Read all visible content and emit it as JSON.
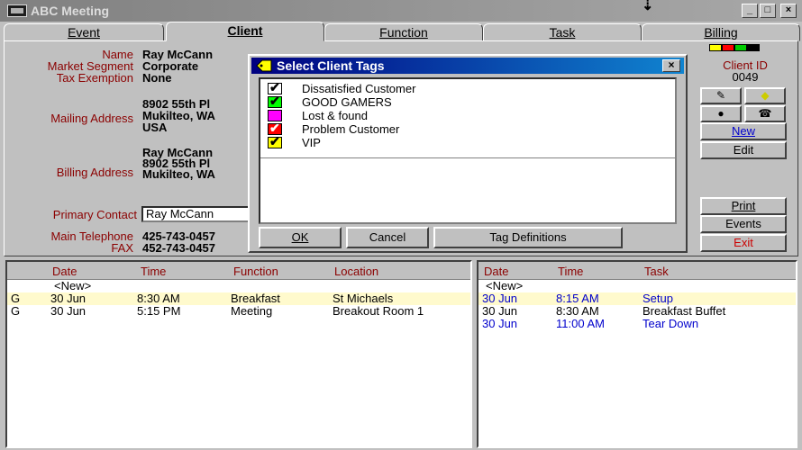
{
  "window": {
    "title": "ABC Meeting",
    "min": "_",
    "max": "□",
    "close": "×",
    "cursor": "⇣"
  },
  "tabs": [
    {
      "label": "Event"
    },
    {
      "label": "Client"
    },
    {
      "label": "Function"
    },
    {
      "label": "Task"
    },
    {
      "label": "Billing"
    }
  ],
  "client": {
    "labels": {
      "name": "Name",
      "segment": "Market Segment",
      "tax": "Tax Exemption",
      "mailing": "Mailing Address",
      "billing": "Billing Address",
      "primary": "Primary Contact",
      "phone": "Main Telephone",
      "fax": "FAX"
    },
    "name": "Ray McCann",
    "segment": "Corporate",
    "tax": "None",
    "mailing": "8902 55th Pl\nMukilteo, WA\nUSA",
    "billing": "Ray McCann\n8902 55th Pl\nMukilteo, WA",
    "primary_contact": "Ray McCann",
    "phone": "425-743-0457",
    "fax": "452-743-0457"
  },
  "status_colors": [
    "#ffff00",
    "#ff0000",
    "#00cc00",
    "#000000"
  ],
  "client_id": {
    "label": "Client ID",
    "value": "0049"
  },
  "side_buttons": {
    "new": "New",
    "edit": "Edit",
    "print": "Print",
    "events": "Events",
    "exit": "Exit"
  },
  "functions_grid": {
    "headers": [
      "Date",
      "Time",
      "Function",
      "Location"
    ],
    "new_label": "<New>",
    "rows": [
      {
        "flag": "G",
        "date": "30 Jun",
        "time": "8:30 AM",
        "function": "Breakfast",
        "location": "St Michaels"
      },
      {
        "flag": "G",
        "date": "30 Jun",
        "time": "5:15 PM",
        "function": "Meeting",
        "location": "Breakout Room 1"
      }
    ]
  },
  "tasks_grid": {
    "headers": [
      "Date",
      "Time",
      "Task"
    ],
    "new_label": "<New>",
    "rows": [
      {
        "date": "30 Jun",
        "time": "8:15 AM",
        "task": "Setup",
        "color": "#0000cc"
      },
      {
        "date": "30 Jun",
        "time": "8:30 AM",
        "task": "Breakfast Buffet",
        "color": "#000000"
      },
      {
        "date": "30 Jun",
        "time": "11:00 AM",
        "task": "Tear Down",
        "color": "#0000cc"
      }
    ]
  },
  "dialog": {
    "title": "Select Client Tags",
    "close": "×",
    "tags": [
      {
        "label": "Dissatisfied Customer",
        "color": "#ffffff",
        "checked": true
      },
      {
        "label": "GOOD GAMERS",
        "color": "#00ff00",
        "checked": true
      },
      {
        "label": "Lost & found",
        "color": "#ff00ff",
        "checked": false
      },
      {
        "label": "Problem Customer",
        "color": "#ff0000",
        "checked": true
      },
      {
        "label": "VIP",
        "color": "#ffff00",
        "checked": true
      }
    ],
    "ok": "OK",
    "cancel": "Cancel",
    "definitions": "Tag Definitions"
  }
}
